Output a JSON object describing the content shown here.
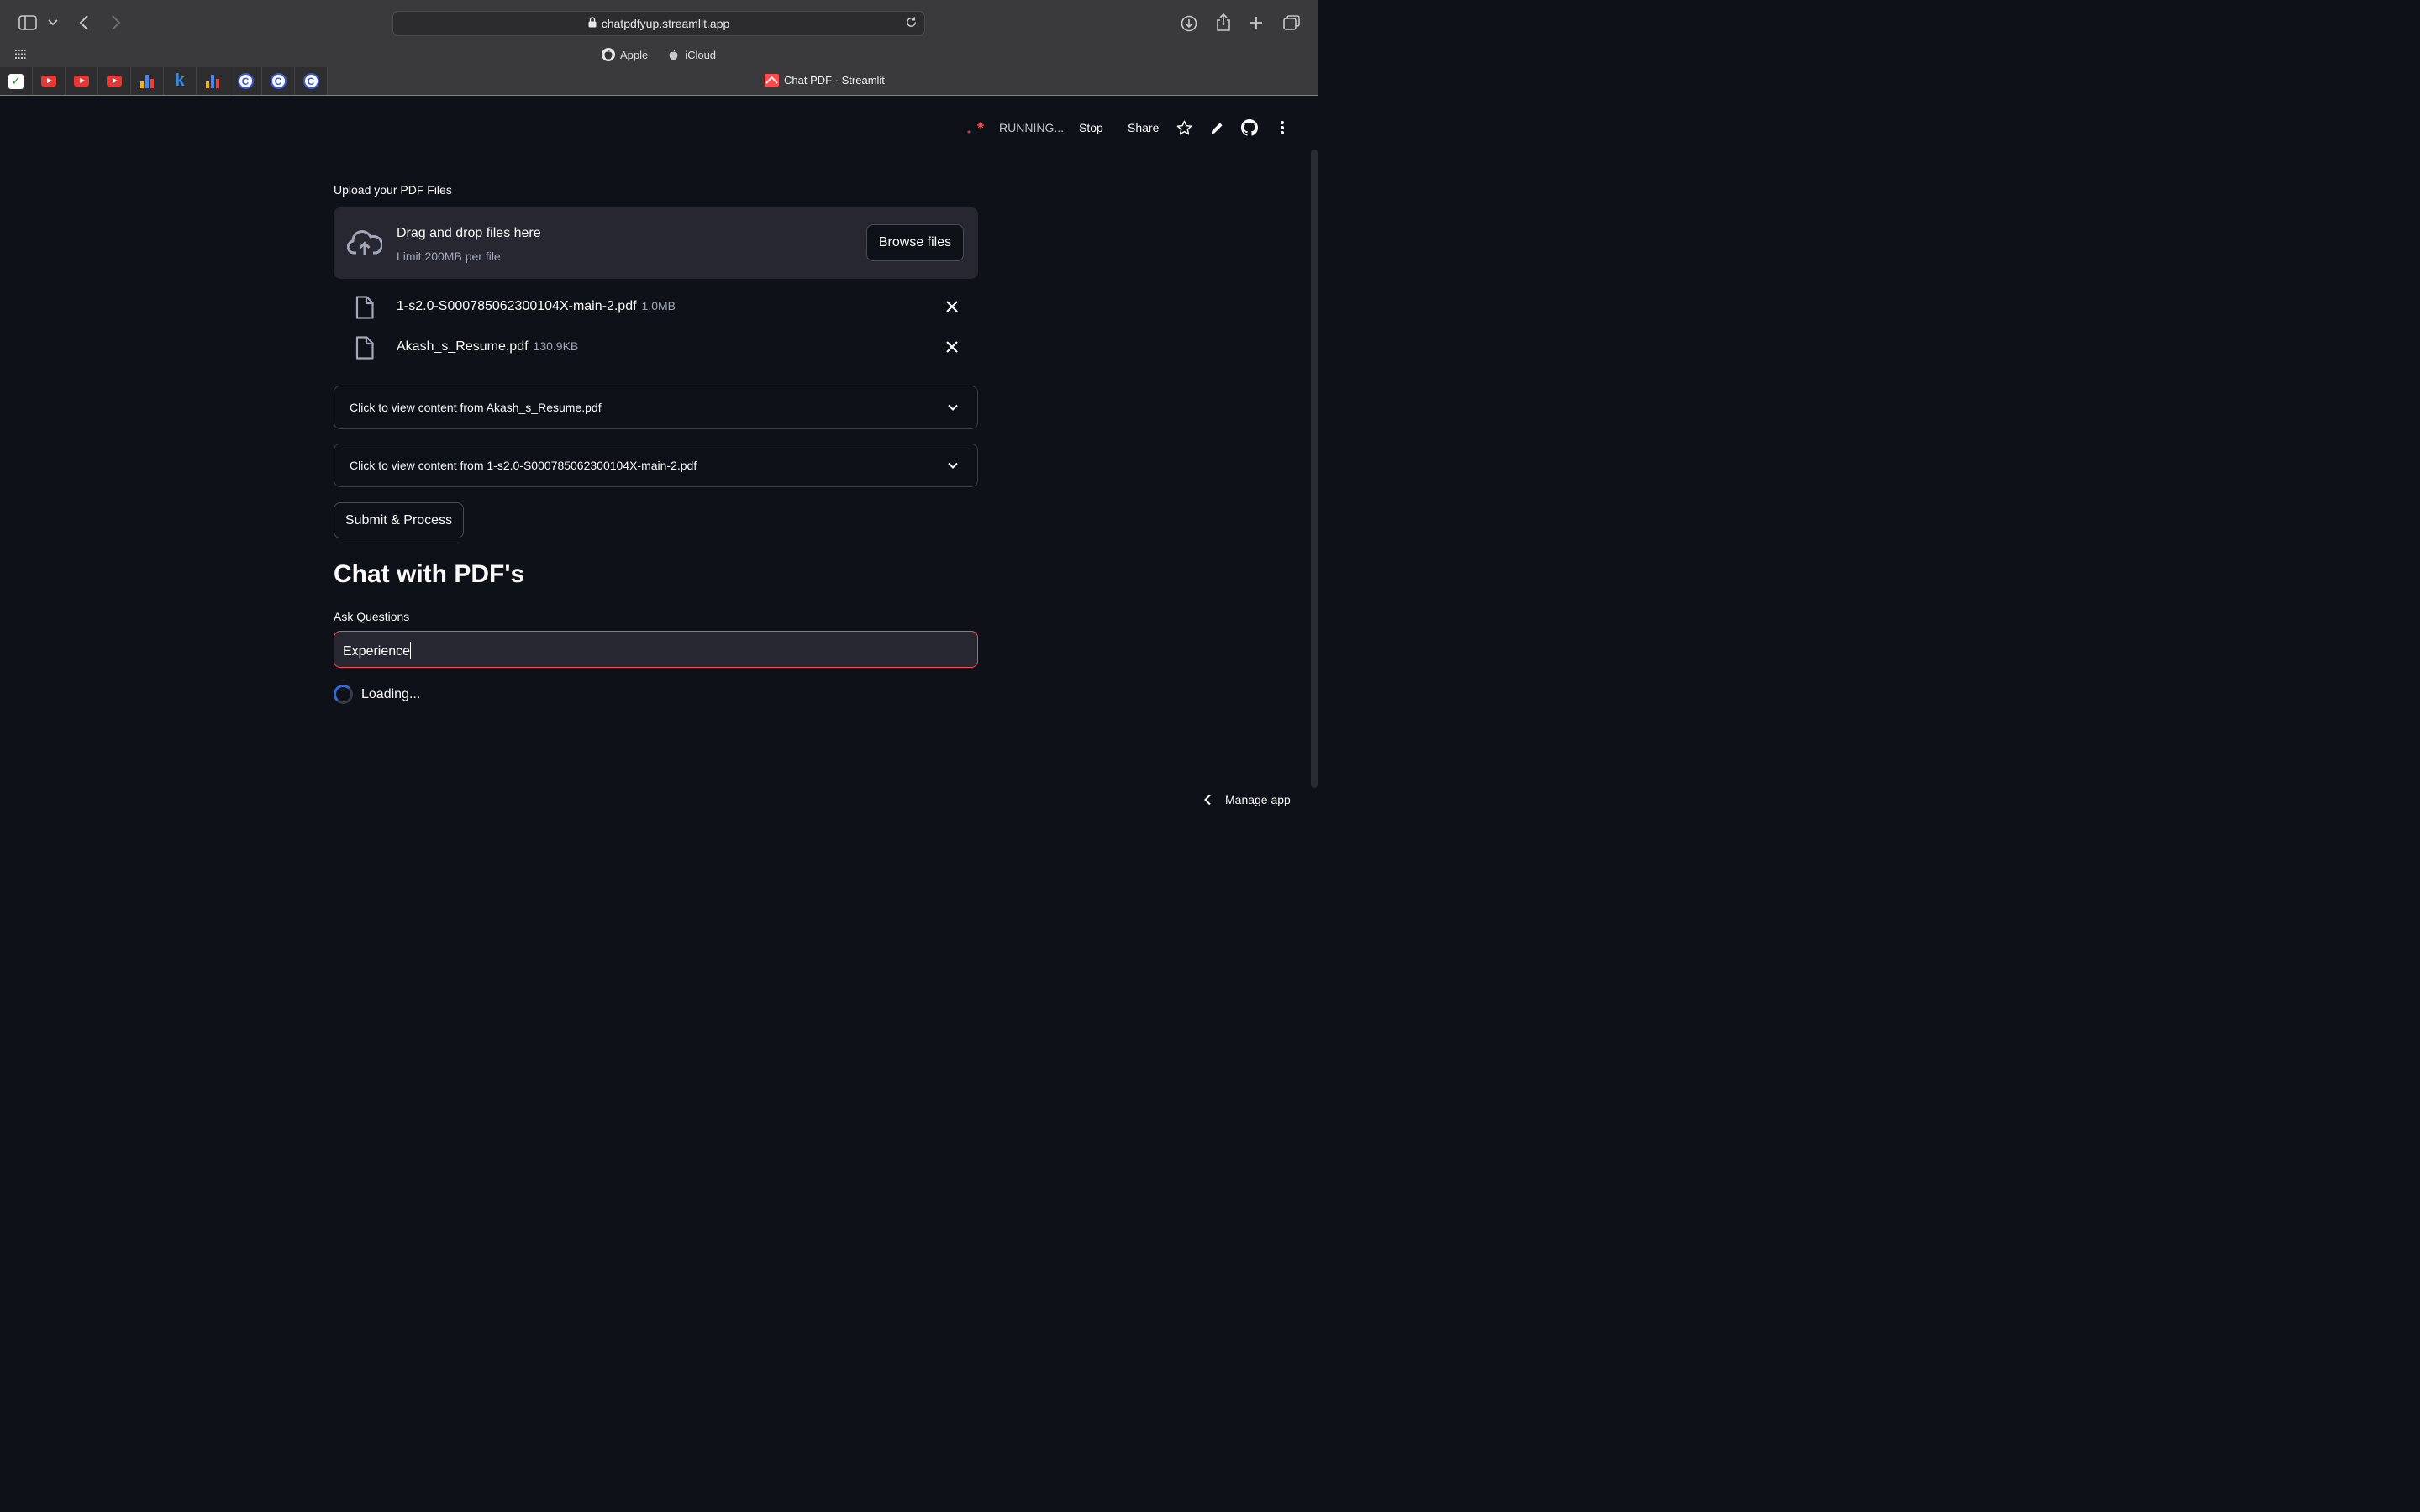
{
  "browser": {
    "url": "chatpdfyup.streamlit.app",
    "favorites": [
      "Apple",
      "iCloud"
    ],
    "active_tab_title": "Chat PDF · Streamlit",
    "pinned_tabs": [
      "checklist-icon",
      "youtube-icon",
      "youtube-icon",
      "youtube-icon",
      "bar-chart-icon",
      "k-icon",
      "bar-chart-icon",
      "c-icon",
      "c-icon",
      "c-icon"
    ],
    "pinned_k": "k",
    "pinned_c": "C"
  },
  "header": {
    "status": "RUNNING...",
    "stop": "Stop",
    "share": "Share"
  },
  "uploader": {
    "label": "Upload your PDF Files",
    "title": "Drag and drop files here",
    "limit": "Limit 200MB per file",
    "browse": "Browse files",
    "files": [
      {
        "name": "1-s2.0-S000785062300104X-main-2.pdf",
        "size": "1.0MB"
      },
      {
        "name": "Akash_s_Resume.pdf",
        "size": "130.9KB"
      }
    ]
  },
  "expanders": [
    {
      "label": "Click to view content from Akash_s_Resume.pdf"
    },
    {
      "label": "Click to view content from 1-s2.0-S000785062300104X-main-2.pdf"
    }
  ],
  "submit_label": "Submit & Process",
  "chat": {
    "title": "Chat with PDF's",
    "ask_label": "Ask Questions",
    "ask_value": "Experience",
    "loading": "Loading..."
  },
  "manage_app": "Manage app",
  "colors": {
    "background": "#0e1117",
    "surface": "#262730",
    "accent": "#ff4b4b",
    "spinner": "#2d6cdf"
  }
}
